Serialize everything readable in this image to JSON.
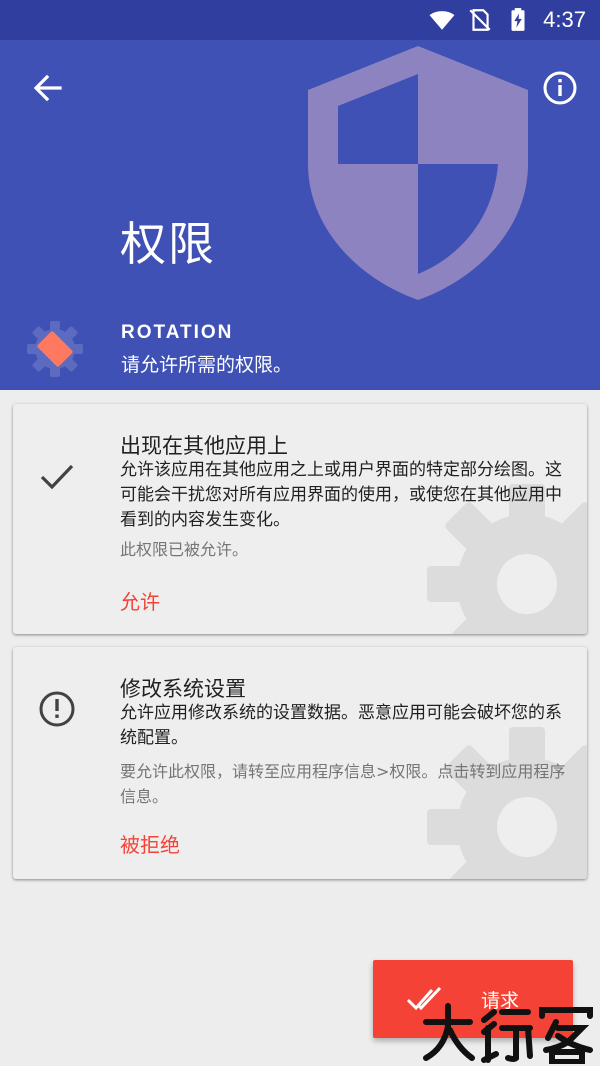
{
  "status_bar": {
    "time": "4:37",
    "icons": [
      "wifi-icon",
      "no-sim-icon",
      "battery-charging-icon"
    ]
  },
  "header": {
    "title": "权限",
    "app_name": "ROTATION",
    "subtitle": "请允许所需的权限。",
    "back_icon": "arrow-back-icon",
    "info_icon": "info-icon",
    "decor_icon": "shield-icon",
    "colors": {
      "primary": "#3f51b5",
      "status_bar": "#303f9f",
      "shield": "#8c83c0"
    }
  },
  "permissions": [
    {
      "title": "出现在其他应用上",
      "description": "允许该应用在其他应用之上或用户界面的特定部分绘图。这可能会干扰您对所有应用界面的使用，或使您在其他应用中看到的内容发生变化。",
      "status": "此权限已被允许。",
      "action": "允许",
      "state_icon": "check-icon"
    },
    {
      "title": "修改系统设置",
      "description": "允许应用修改系统的设置数据。恶意应用可能会破坏您的系统配置。",
      "status": "要允许此权限，请转至应用程序信息>权限。点击转到应用程序信息。",
      "action": "被拒绝",
      "state_icon": "alert-circle-icon"
    }
  ],
  "request_button": {
    "label": "请求",
    "icon": "done-all-icon",
    "color": "#f44336"
  }
}
